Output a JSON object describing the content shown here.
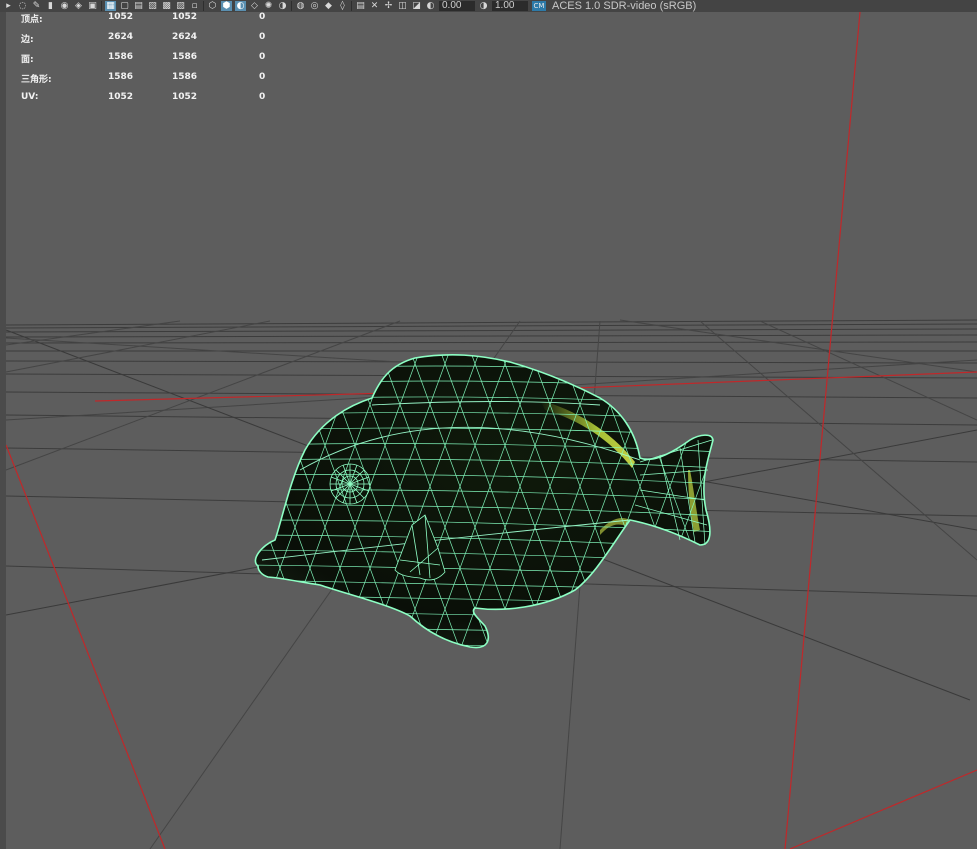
{
  "toolbar": {
    "exposure_value": "0.00",
    "gamma_value": "1.00",
    "badge_label": "CM",
    "color_space": "ACES 1.0 SDR-video (sRGB)",
    "icons": [
      "select-icon",
      "lasso-icon",
      "paint-icon",
      "bookmark-icon",
      "camera-icon",
      "camera-attr-icon",
      "image-plane-icon",
      "grid-icon",
      "film-gate-icon",
      "resolution-gate-icon",
      "gate-mask-icon",
      "field-chart-icon",
      "safe-action-icon",
      "safe-title-icon",
      "wireframe-icon",
      "smooth-shade-icon",
      "default-material-icon",
      "textured-icon",
      "use-lights-icon",
      "shadows-icon",
      "ambient-occlusion-icon",
      "motion-blur-icon",
      "anti-alias-icon",
      "depth-of-field-icon",
      "isolate-icon",
      "xray-icon",
      "xray-joints-icon",
      "xray-active-icon",
      "backface-icon"
    ]
  },
  "hud": {
    "rows": [
      {
        "label": "顶点:",
        "v1": "1052",
        "v2": "1052",
        "v3": "0"
      },
      {
        "label": "边:",
        "v1": "2624",
        "v2": "2624",
        "v3": "0"
      },
      {
        "label": "面:",
        "v1": "1586",
        "v2": "1586",
        "v3": "0"
      },
      {
        "label": "三角形:",
        "v1": "1586",
        "v2": "1586",
        "v3": "0"
      },
      {
        "label": "UV:",
        "v1": "1052",
        "v2": "1052",
        "v3": "0"
      }
    ]
  },
  "colors": {
    "background": "#5d5d5d",
    "grid": "#3a3a3a",
    "axis": "#c0282a",
    "wireframe": "#7dffb8",
    "model_shade": "#0b1208",
    "highlight": "#b6d23a"
  }
}
